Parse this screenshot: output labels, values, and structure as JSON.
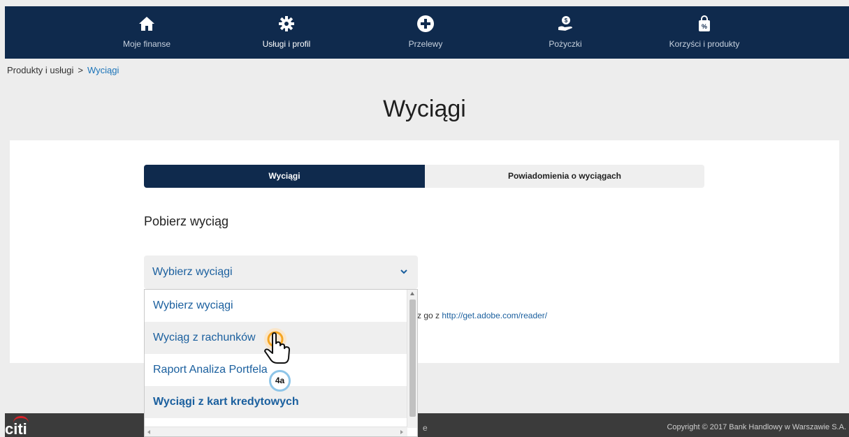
{
  "nav": {
    "items": [
      {
        "label": "Moje finanse",
        "icon": "home-icon"
      },
      {
        "label": "Usługi i profil",
        "icon": "gear-icon"
      },
      {
        "label": "Przelewy",
        "icon": "plus-circle-icon"
      },
      {
        "label": "Pożyczki",
        "icon": "loan-hand-icon"
      },
      {
        "label": "Korzyści i produkty",
        "icon": "shopping-bag-percent-icon"
      }
    ]
  },
  "breadcrumb": {
    "parent": "Produkty i usługi",
    "separator": ">",
    "current": "Wyciągi"
  },
  "page_title": "Wyciągi",
  "tabs": [
    {
      "label": "Wyciągi",
      "active": true
    },
    {
      "label": "Powiadomienia o wyciągach",
      "active": false
    }
  ],
  "section_heading": "Pobierz wyciąg",
  "select": {
    "value": "Wybierz wyciągi",
    "options": [
      "Wybierz wyciągi",
      "Wyciąg z rachunków",
      "Raport Analiza Portfela",
      "Wyciągi z kart kredytowych"
    ]
  },
  "adobe_note": {
    "prefix": "z go z",
    "link": "http://get.adobe.com/reader/"
  },
  "footer": {
    "logo": "citi",
    "fragment": "e",
    "copyright": "Copyright © 2017 Bank Handlowy w Warszawie S.A."
  },
  "overlay": {
    "step_badge": "4a"
  },
  "colors": {
    "navbar": "#0f2a4d",
    "accent_link": "#1a5f9e",
    "footer": "#3b3b3b",
    "cursor_highlight": "#f5a623"
  }
}
